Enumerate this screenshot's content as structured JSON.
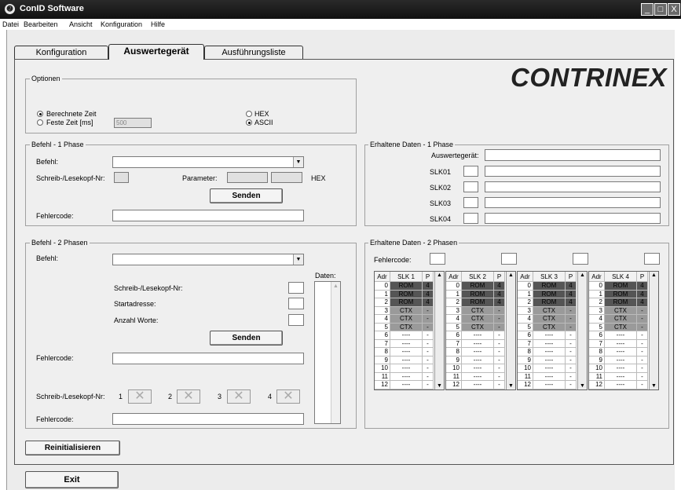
{
  "window": {
    "title": "ConID Software",
    "minimize": "_",
    "maximize": "□",
    "close": "X"
  },
  "menu": [
    "Datei",
    "Bearbeiten",
    "Ansicht",
    "Konfiguration",
    "Hilfe"
  ],
  "tabs": [
    "Konfiguration",
    "Auswertegerät",
    "Ausführungsliste"
  ],
  "logo": "CONTRINEX",
  "optionen": {
    "legend": "Optionen",
    "berechnete_zeit": "Berechnete Zeit",
    "feste_zeit": "Feste Zeit [ms]",
    "feste_zeit_value": "500",
    "hex": "HEX",
    "ascii": "ASCII"
  },
  "befehl1": {
    "legend": "Befehl - 1 Phase",
    "befehl_label": "Befehl:",
    "kopf_label": "Schreib-/Lesekopf-Nr:",
    "parameter_label": "Parameter:",
    "hex_label": "HEX",
    "senden": "Senden",
    "fehlercode_label": "Fehlercode:"
  },
  "erhalten1": {
    "legend": "Erhaltene Daten - 1 Phase",
    "auswertegeraet": "Auswertegerät:",
    "slk": [
      "SLK01",
      "SLK02",
      "SLK03",
      "SLK04"
    ]
  },
  "befehl2": {
    "legend": "Befehl - 2 Phasen",
    "befehl_label": "Befehl:",
    "daten_label": "Daten:",
    "kopf_label": "Schreib-/Lesekopf-Nr:",
    "startadresse_label": "Startadresse:",
    "anzahl_label": "Anzahl Worte:",
    "senden": "Senden",
    "fehlercode_label": "Fehlercode:",
    "kopf_row_label": "Schreib-/Lesekopf-Nr:",
    "kopf_nums": [
      "1",
      "2",
      "3",
      "4"
    ],
    "fehlercode2_label": "Fehlercode:"
  },
  "erhalten2": {
    "legend": "Erhaltene Daten - 2 Phasen",
    "fehlercode_label": "Fehlercode:",
    "tables": [
      {
        "headers": [
          "Adr",
          "SLK 1",
          "P"
        ]
      },
      {
        "headers": [
          "Adr",
          "SLK 2",
          "P"
        ]
      },
      {
        "headers": [
          "Adr",
          "SLK 3",
          "P"
        ]
      },
      {
        "headers": [
          "Adr",
          "SLK 4",
          "P"
        ]
      }
    ],
    "rows": [
      {
        "adr": "0",
        "slk": "ROM",
        "p": "4",
        "kind": "rom"
      },
      {
        "adr": "1",
        "slk": "ROM",
        "p": "4",
        "kind": "rom"
      },
      {
        "adr": "2",
        "slk": "ROM",
        "p": "4",
        "kind": "rom"
      },
      {
        "adr": "3",
        "slk": "CTX",
        "p": "-",
        "kind": "ctx"
      },
      {
        "adr": "4",
        "slk": "CTX",
        "p": "-",
        "kind": "ctx"
      },
      {
        "adr": "5",
        "slk": "CTX",
        "p": "-",
        "kind": "ctx"
      },
      {
        "adr": "6",
        "slk": "----",
        "p": "-",
        "kind": "empty"
      },
      {
        "adr": "7",
        "slk": "----",
        "p": "-",
        "kind": "empty"
      },
      {
        "adr": "8",
        "slk": "----",
        "p": "-",
        "kind": "empty"
      },
      {
        "adr": "9",
        "slk": "----",
        "p": "-",
        "kind": "empty"
      },
      {
        "adr": "10",
        "slk": "----",
        "p": "-",
        "kind": "empty"
      },
      {
        "adr": "11",
        "slk": "----",
        "p": "-",
        "kind": "empty"
      },
      {
        "adr": "12",
        "slk": "----",
        "p": "-",
        "kind": "empty"
      }
    ]
  },
  "buttons": {
    "reinitialisieren": "Reinitialisieren",
    "exit": "Exit"
  },
  "colors": {
    "rom": "#555555",
    "ctx": "#9a9a9a"
  }
}
